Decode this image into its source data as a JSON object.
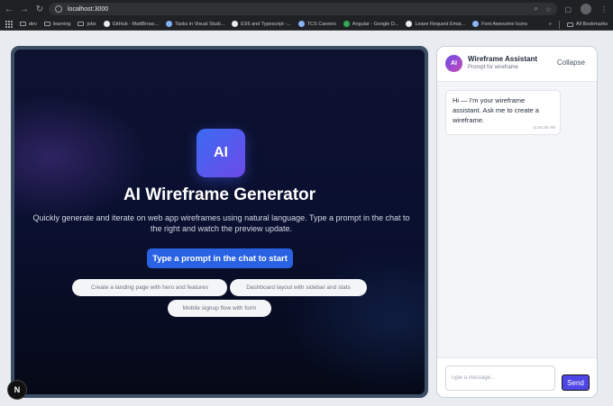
{
  "browser": {
    "url": "localhost:3000",
    "bookmarks": [
      {
        "label": "dev",
        "kind": "folder"
      },
      {
        "label": "learning",
        "kind": "folder"
      },
      {
        "label": "jobs",
        "kind": "folder"
      },
      {
        "label": "GitHub - MattBroac...",
        "kind": "site"
      },
      {
        "label": "Tasks in Visual Studi...",
        "kind": "site"
      },
      {
        "label": "ES6 and Typescript -...",
        "kind": "site"
      },
      {
        "label": "TCS Careers",
        "kind": "site"
      },
      {
        "label": "Angular - Google D...",
        "kind": "site"
      },
      {
        "label": "Leave Request Emai...",
        "kind": "site"
      },
      {
        "label": "Font Awesome Icons",
        "kind": "site"
      }
    ],
    "more_label": "»",
    "all_bookmarks_label": "All Bookmarks"
  },
  "preview": {
    "logo_text": "AI",
    "title": "AI Wireframe Generator",
    "subtitle": "Quickly generate and iterate on web app wireframes using natural language. Type a prompt in the chat to the right and watch the preview update.",
    "cta_label": "Type a prompt in the chat to start",
    "suggestions": [
      "Create a landing page with hero and features",
      "Dashboard layout with sidebar and stats",
      "Mobile signup flow with form"
    ]
  },
  "chat": {
    "avatar_text": "AI",
    "title": "Wireframe Assistant",
    "subtitle": "Prompt for wireframe",
    "collapse_label": "Collapse",
    "messages": [
      {
        "text": "Hi — I'm your wireframe assistant. Ask me to create a wireframe.",
        "time": "11:55:35 AM"
      }
    ],
    "input_placeholder": "Type a message...",
    "send_label": "Send"
  },
  "dev_badge": "N",
  "colors": {
    "accent": "#4f46e5",
    "cta": "#2a62e4",
    "logo_gradient_start": "#3b6bf2",
    "logo_gradient_end": "#6d4ae8",
    "preview_bg": "#0a1030"
  },
  "icons": [
    "back-arrow-icon",
    "forward-arrow-icon",
    "reload-icon",
    "site-info-icon",
    "zoom-icon",
    "star-icon",
    "extensions-icon",
    "profile-avatar",
    "menu-dots-icon",
    "apps-grid-icon",
    "folder-icon"
  ]
}
